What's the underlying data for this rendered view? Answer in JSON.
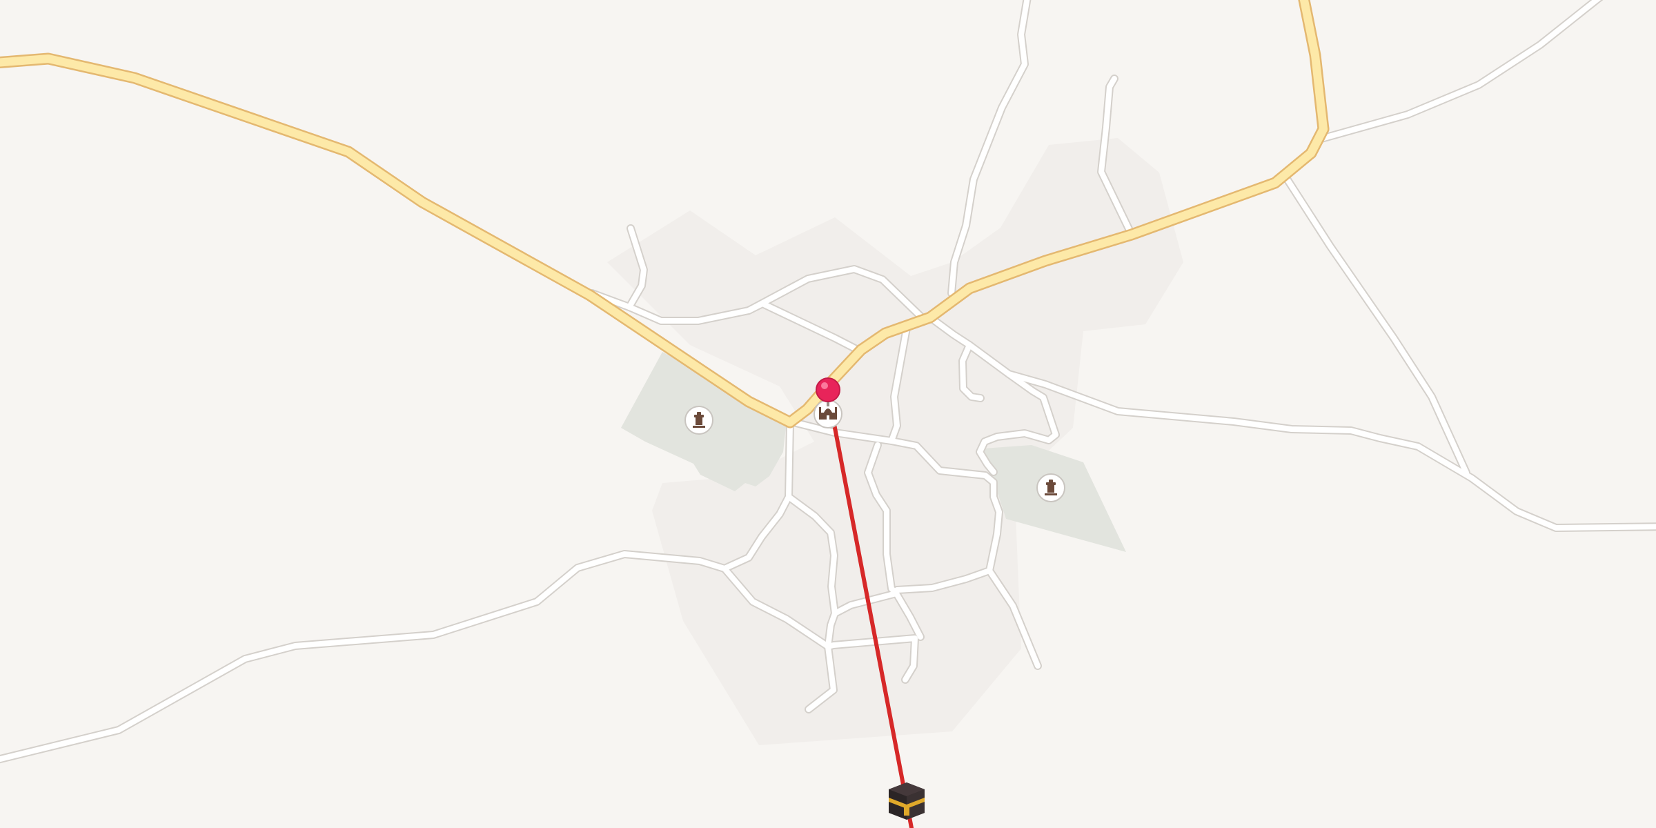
{
  "map": {
    "colors": {
      "background": "#f7f5f2",
      "landuse": "#f1eeeb",
      "cemetery": "#e2e4de",
      "main_road_fill": "#fde9a8",
      "main_road_casing": "#e4b870",
      "minor_road_fill": "#ffffff",
      "minor_road_casing": "#d4d0cb",
      "qibla_line": "#d62828",
      "location_pin": "#e8245a"
    },
    "pois": [
      {
        "type": "cemetery",
        "icon": "cemetery-icon"
      },
      {
        "type": "cemetery",
        "icon": "cemetery-icon"
      },
      {
        "type": "mosque",
        "icon": "mosque-icon"
      }
    ],
    "location_pin": {
      "icon": "location-pin-icon"
    },
    "qibla": {
      "icon": "kaaba-icon"
    }
  }
}
